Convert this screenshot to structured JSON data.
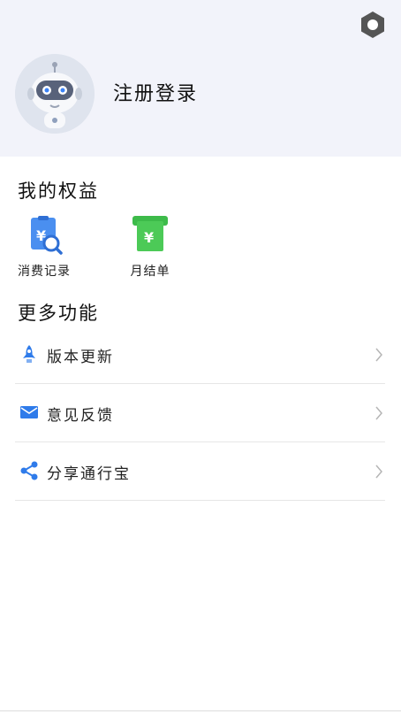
{
  "header": {
    "login_label": "注册登录"
  },
  "benefits": {
    "title": "我的权益",
    "items": [
      {
        "label": "消费记录",
        "icon": "consumption-record-icon"
      },
      {
        "label": "月结单",
        "icon": "monthly-statement-icon"
      }
    ]
  },
  "more": {
    "title": "更多功能",
    "items": [
      {
        "label": "版本更新",
        "icon": "rocket-icon"
      },
      {
        "label": "意见反馈",
        "icon": "mail-icon"
      },
      {
        "label": "分享通行宝",
        "icon": "share-icon"
      }
    ]
  },
  "colors": {
    "header_bg": "#f2f3fa",
    "accent_blue": "#2f7bea",
    "accent_green": "#3dbb4a",
    "settings_gray": "#555555"
  }
}
